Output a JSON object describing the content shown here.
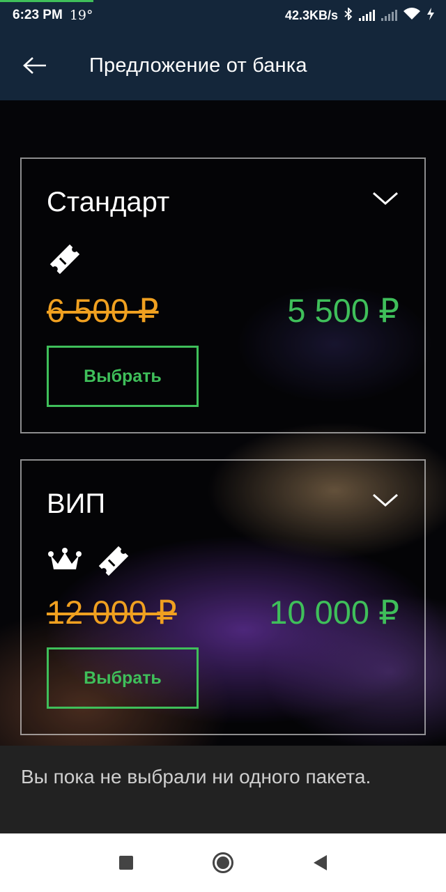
{
  "status_bar": {
    "time": "6:23 PM",
    "temperature": "19°",
    "network_speed": "42.3KB/s",
    "icons": [
      "bluetooth-icon",
      "signal-icon",
      "signal-off-icon",
      "wifi-icon",
      "charging-icon"
    ]
  },
  "app_bar": {
    "back_icon": "arrow-left-icon",
    "title": "Предложение от банка"
  },
  "packages": [
    {
      "name": "Стандарт",
      "icons": [
        "ticket-icon"
      ],
      "old_price": "6 500 ₽",
      "new_price": "5 500 ₽",
      "button_label": "Выбрать"
    },
    {
      "name": "ВИП",
      "icons": [
        "crown-icon",
        "ticket-icon"
      ],
      "old_price": "12 000 ₽",
      "new_price": "10 000 ₽",
      "button_label": "Выбрать"
    }
  ],
  "snackbar": {
    "message": "Вы пока не выбрали ни одного пакета."
  },
  "nav_bar": {
    "icons": [
      "recents-square-icon",
      "home-circle-icon",
      "back-triangle-icon"
    ]
  },
  "colors": {
    "app_bar": "#14263a",
    "accent_green": "#3fbf5a",
    "old_price_orange": "#f0a020",
    "snackbar": "#222222"
  }
}
